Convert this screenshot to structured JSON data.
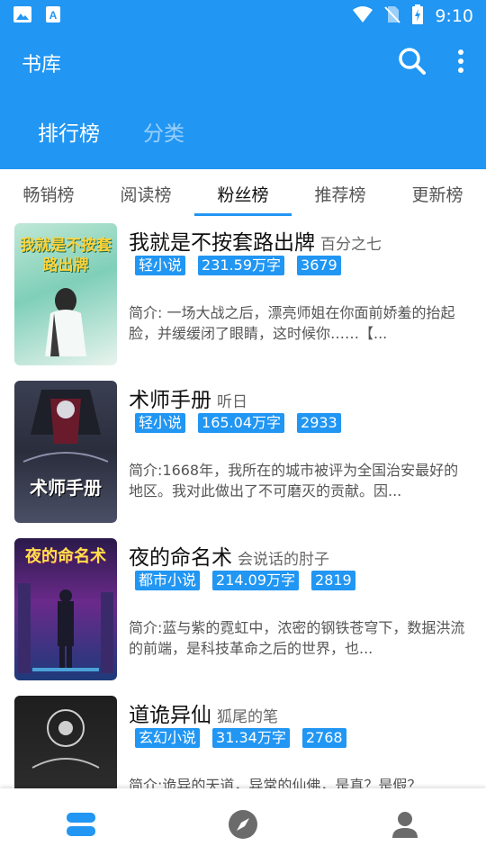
{
  "status": {
    "time": "9:10"
  },
  "appbar": {
    "title": "书库",
    "search_icon": "search-icon",
    "menu_icon": "more-vertical-icon"
  },
  "topnav": {
    "tabs": [
      {
        "label": "排行榜",
        "active": true
      },
      {
        "label": "分类",
        "active": false
      }
    ]
  },
  "subtabs": [
    "畅销榜",
    "阅读榜",
    "粉丝榜",
    "推荐榜",
    "更新榜"
  ],
  "subtab_active": "粉丝榜",
  "books": [
    {
      "title": "我就是不按套路出牌",
      "author": "百分之七",
      "tags": [
        "轻小说",
        "231.59万字",
        "3679"
      ],
      "intro": "简介: 一场大战之后，漂亮师姐在你面前娇羞的抬起脸，并缓缓闭了眼睛，这时候你……【...",
      "cover_text": "我就是不按套路出牌"
    },
    {
      "title": "术师手册",
      "author": "听日",
      "tags": [
        "轻小说",
        "165.04万字",
        "2933"
      ],
      "intro": "简介:1668年，我所在的城市被评为全国治安最好的地区。我对此做出了不可磨灭的贡献。因...",
      "cover_text": "术师手册"
    },
    {
      "title": "夜的命名术",
      "author": "会说话的肘子",
      "tags": [
        "都市小说",
        "214.09万字",
        "2819"
      ],
      "intro": "简介:蓝与紫的霓虹中，浓密的钢铁苍穹下，数据洪流的前端，是科技革命之后的世界，也...",
      "cover_text": "夜的命名术"
    },
    {
      "title": "道诡异仙",
      "author": "狐尾的笔",
      "tags": [
        "玄幻小说",
        "31.34万字",
        "2768"
      ],
      "intro": "简介:诡异的天道，异常的仙佛，是真？是假？",
      "cover_text": ""
    }
  ],
  "bottomnav": [
    "bookshelf-icon",
    "compass-icon",
    "person-icon"
  ],
  "colors": {
    "primary": "#2196f3"
  }
}
